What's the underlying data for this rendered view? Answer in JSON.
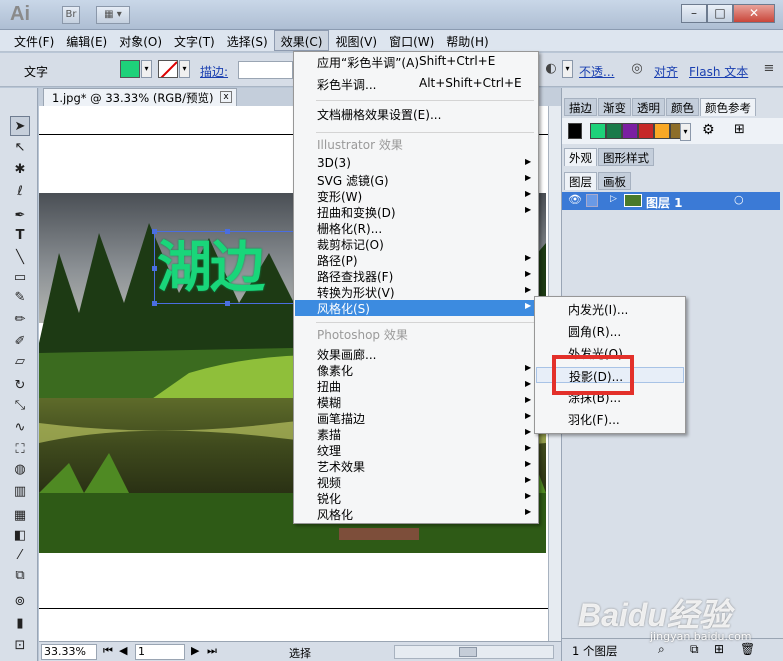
{
  "app": {
    "logo": "Ai",
    "bridge_label": "Br"
  },
  "menubar": [
    {
      "label": "文件(F)"
    },
    {
      "label": "编辑(E)"
    },
    {
      "label": "对象(O)"
    },
    {
      "label": "文字(T)"
    },
    {
      "label": "选择(S)"
    },
    {
      "label": "效果(C)"
    },
    {
      "label": "视图(V)"
    },
    {
      "label": "窗口(W)"
    },
    {
      "label": "帮助(H)"
    }
  ],
  "control": {
    "label": "文字",
    "fill_color": "#1ed27a",
    "stroke_label": "描边:",
    "opacity_link": "不透...",
    "align_link": "对齐",
    "flash_link": "Flash 文本"
  },
  "document": {
    "tab_title": "1.jpg* @ 33.33% (RGB/预览)",
    "close": "x",
    "art_text": "湖边"
  },
  "status": {
    "zoom": "33.33%",
    "page": "1",
    "mode": "选择"
  },
  "panels": {
    "tabs_top": [
      "描边",
      "渐变",
      "透明",
      "颜色",
      "颜色参考"
    ],
    "tabs_mid": [
      "外观",
      "图形样式"
    ],
    "tabs_layers": [
      "图层",
      "画板"
    ],
    "layer_name": "图层 1",
    "layer_count": "1 个图层",
    "swatch_colors": [
      "#1ed27a",
      "#1a7a4a",
      "#7b1fa2",
      "#c62828",
      "#f9a825",
      "#8d6e2a"
    ]
  },
  "effect_menu": {
    "items": [
      {
        "label": "应用“彩色半调”(A)",
        "shortcut": "Shift+Ctrl+E"
      },
      {
        "label": "彩色半调...",
        "shortcut": "Alt+Shift+Ctrl+E"
      },
      {
        "label": "文档栅格效果设置(E)..."
      },
      {
        "label": "Illustrator 效果",
        "disabled": true
      },
      {
        "label": "3D(3)",
        "sub": true
      },
      {
        "label": "SVG 滤镜(G)",
        "sub": true
      },
      {
        "label": "变形(W)",
        "sub": true
      },
      {
        "label": "扭曲和变换(D)",
        "sub": true
      },
      {
        "label": "栅格化(R)..."
      },
      {
        "label": "裁剪标记(O)"
      },
      {
        "label": "路径(P)",
        "sub": true
      },
      {
        "label": "路径查找器(F)",
        "sub": true
      },
      {
        "label": "转换为形状(V)",
        "sub": true
      },
      {
        "label": "风格化(S)",
        "sub": true,
        "highlighted": true
      },
      {
        "label": "Photoshop 效果",
        "disabled": true
      },
      {
        "label": "效果画廊..."
      },
      {
        "label": "像素化",
        "sub": true
      },
      {
        "label": "扭曲",
        "sub": true
      },
      {
        "label": "模糊",
        "sub": true
      },
      {
        "label": "画笔描边",
        "sub": true
      },
      {
        "label": "素描",
        "sub": true
      },
      {
        "label": "纹理",
        "sub": true
      },
      {
        "label": "艺术效果",
        "sub": true
      },
      {
        "label": "视频",
        "sub": true
      },
      {
        "label": "锐化",
        "sub": true
      },
      {
        "label": "风格化",
        "sub": true
      }
    ]
  },
  "stylize_submenu": {
    "items": [
      {
        "label": "内发光(I)..."
      },
      {
        "label": "圆角(R)..."
      },
      {
        "label": "外发光(O)..."
      },
      {
        "label": "投影(D)...",
        "highlighted": true
      },
      {
        "label": "涂抹(B)..."
      },
      {
        "label": "羽化(F)..."
      }
    ]
  },
  "watermark": {
    "brand": "Baidu经验",
    "url": "jingyan.baidu.com"
  }
}
